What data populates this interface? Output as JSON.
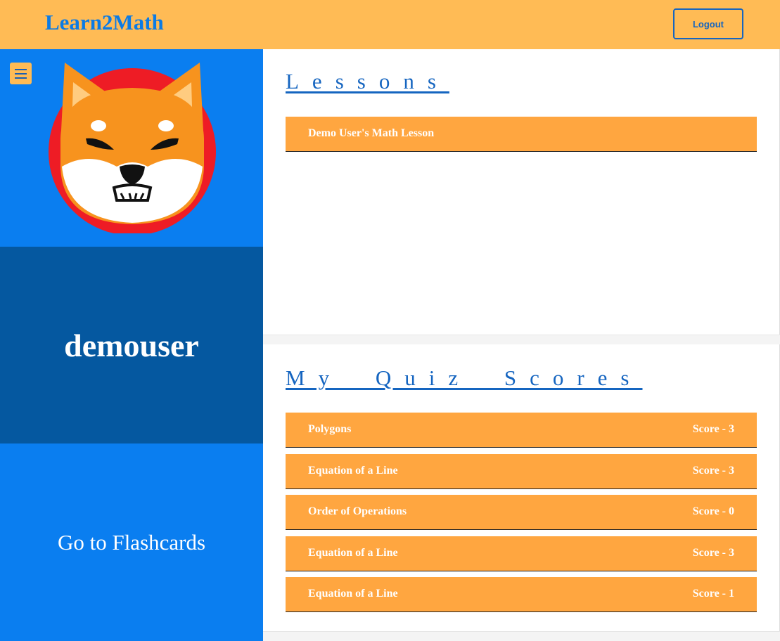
{
  "header": {
    "brand": "Learn2Math",
    "logout_label": "Logout"
  },
  "sidebar": {
    "menu_icon": "hamburger-menu-icon",
    "avatar_icon": "shiba-inu-avatar-icon",
    "username": "demouser",
    "flashcards_link": "Go to Flashcards"
  },
  "lessons": {
    "title": "Lessons",
    "items": [
      {
        "label": "Demo User's Math Lesson"
      }
    ]
  },
  "quiz_scores": {
    "title": "My Quiz Scores",
    "items": [
      {
        "label": "Polygons",
        "score": "Score - 3"
      },
      {
        "label": "Equation of a Line",
        "score": "Score - 3"
      },
      {
        "label": "Order of Operations",
        "score": "Score - 0"
      },
      {
        "label": "Equation of a Line",
        "score": "Score - 3"
      },
      {
        "label": "Equation of a Line",
        "score": "Score - 1"
      }
    ]
  },
  "colors": {
    "header_bg": "#ffbb55",
    "sidebar_blue": "#0a7ef0",
    "sidebar_dark": "#0558a0",
    "row_orange": "#ffa640",
    "link_blue": "#1565c0"
  }
}
